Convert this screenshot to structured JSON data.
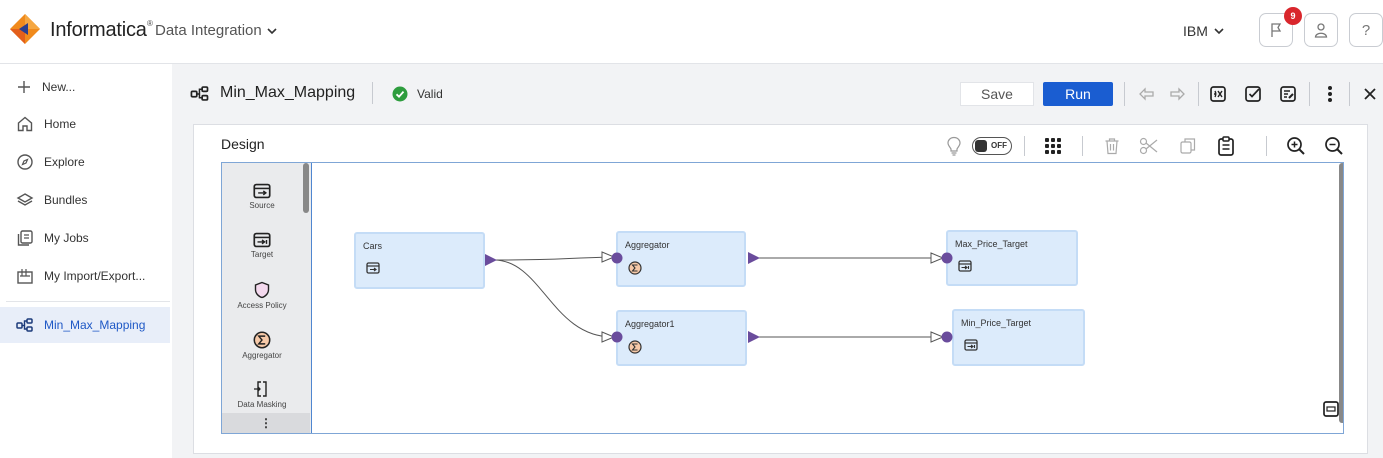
{
  "topbar": {
    "brand": "Informatica",
    "brand_mark": "®",
    "product": "Data Integration",
    "org": "IBM",
    "notifications_count": "9",
    "help_label": "?"
  },
  "sidebar": {
    "items": [
      {
        "label": "New...",
        "icon": "plus-icon"
      },
      {
        "label": "Home",
        "icon": "home-icon"
      },
      {
        "label": "Explore",
        "icon": "explore-icon"
      },
      {
        "label": "Bundles",
        "icon": "bundles-icon"
      },
      {
        "label": "My Jobs",
        "icon": "jobs-icon"
      },
      {
        "label": "My Import/Export...",
        "icon": "import-export-icon"
      }
    ],
    "open_tab": {
      "label": "Min_Max_Mapping",
      "icon": "mapping-icon"
    }
  },
  "mapping": {
    "title": "Min_Max_Mapping",
    "status": "Valid",
    "save_label": "Save",
    "run_label": "Run"
  },
  "design": {
    "title": "Design",
    "toggle_label": "OFF"
  },
  "palette": {
    "items": [
      {
        "label": "Source",
        "icon": "source-icon"
      },
      {
        "label": "Target",
        "icon": "target-icon"
      },
      {
        "label": "Access Policy",
        "icon": "access-policy-icon"
      },
      {
        "label": "Aggregator",
        "icon": "aggregator-icon"
      },
      {
        "label": "Data Masking",
        "icon": "data-masking-icon"
      }
    ],
    "more_label": "⋮"
  },
  "nodes": {
    "cars": "Cars",
    "agg": "Aggregator",
    "agg1": "Aggregator1",
    "max": "Max_Price_Target",
    "min": "Min_Price_Target"
  },
  "colors": {
    "accent": "#1a5dd1",
    "node_fill": "#dcebfb",
    "port": "#6a4c9c",
    "valid": "#2e9d3e",
    "badge": "#d9262c"
  }
}
